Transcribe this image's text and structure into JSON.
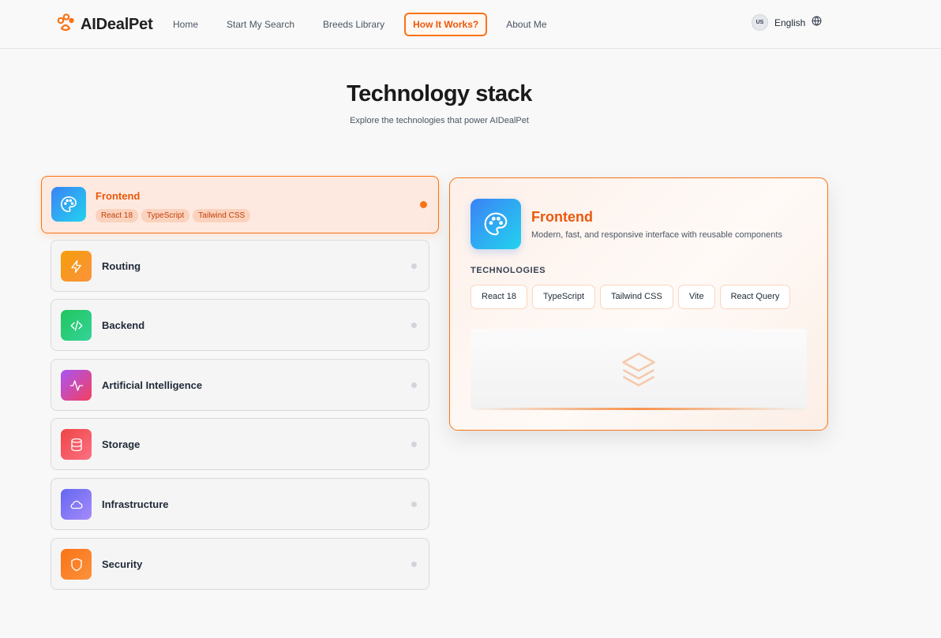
{
  "header": {
    "logo_text": "AIDealPet",
    "nav": [
      "Home",
      "Start My Search",
      "Breeds Library",
      "How It Works?",
      "About Me"
    ],
    "active_nav": "How It Works?",
    "flag_text": "US",
    "language": "English"
  },
  "page": {
    "title": "Technology stack",
    "subtitle": "Explore the technologies that power AIDealPet"
  },
  "categories": [
    {
      "label": "Frontend",
      "icon": "palette-icon",
      "color": "#3b82f6",
      "active": true,
      "chips": [
        "React 18",
        "TypeScript",
        "Tailwind CSS"
      ]
    },
    {
      "label": "Routing",
      "icon": "lightning-icon",
      "color": "#f59e0b"
    },
    {
      "label": "Backend",
      "icon": "code-icon",
      "color": "#22c55e"
    },
    {
      "label": "Artificial Intelligence",
      "icon": "activity-icon",
      "color": "#a855f7"
    },
    {
      "label": "Storage",
      "icon": "database-icon",
      "color": "#ef4444"
    },
    {
      "label": "Infrastructure",
      "icon": "cloud-icon",
      "color": "#6366f1"
    },
    {
      "label": "Security",
      "icon": "shield-icon",
      "color": "#f97316"
    }
  ],
  "detail": {
    "title": "Frontend",
    "description": "Modern, fast, and responsive interface with reusable components",
    "technologies_heading": "TECHNOLOGIES",
    "technologies": [
      "React 18",
      "TypeScript",
      "Tailwind CSS",
      "Vite",
      "React Query"
    ],
    "preview_icon": "layers-icon"
  },
  "colors": {
    "accent": "#f97316",
    "accent_text": "#ea580c"
  }
}
